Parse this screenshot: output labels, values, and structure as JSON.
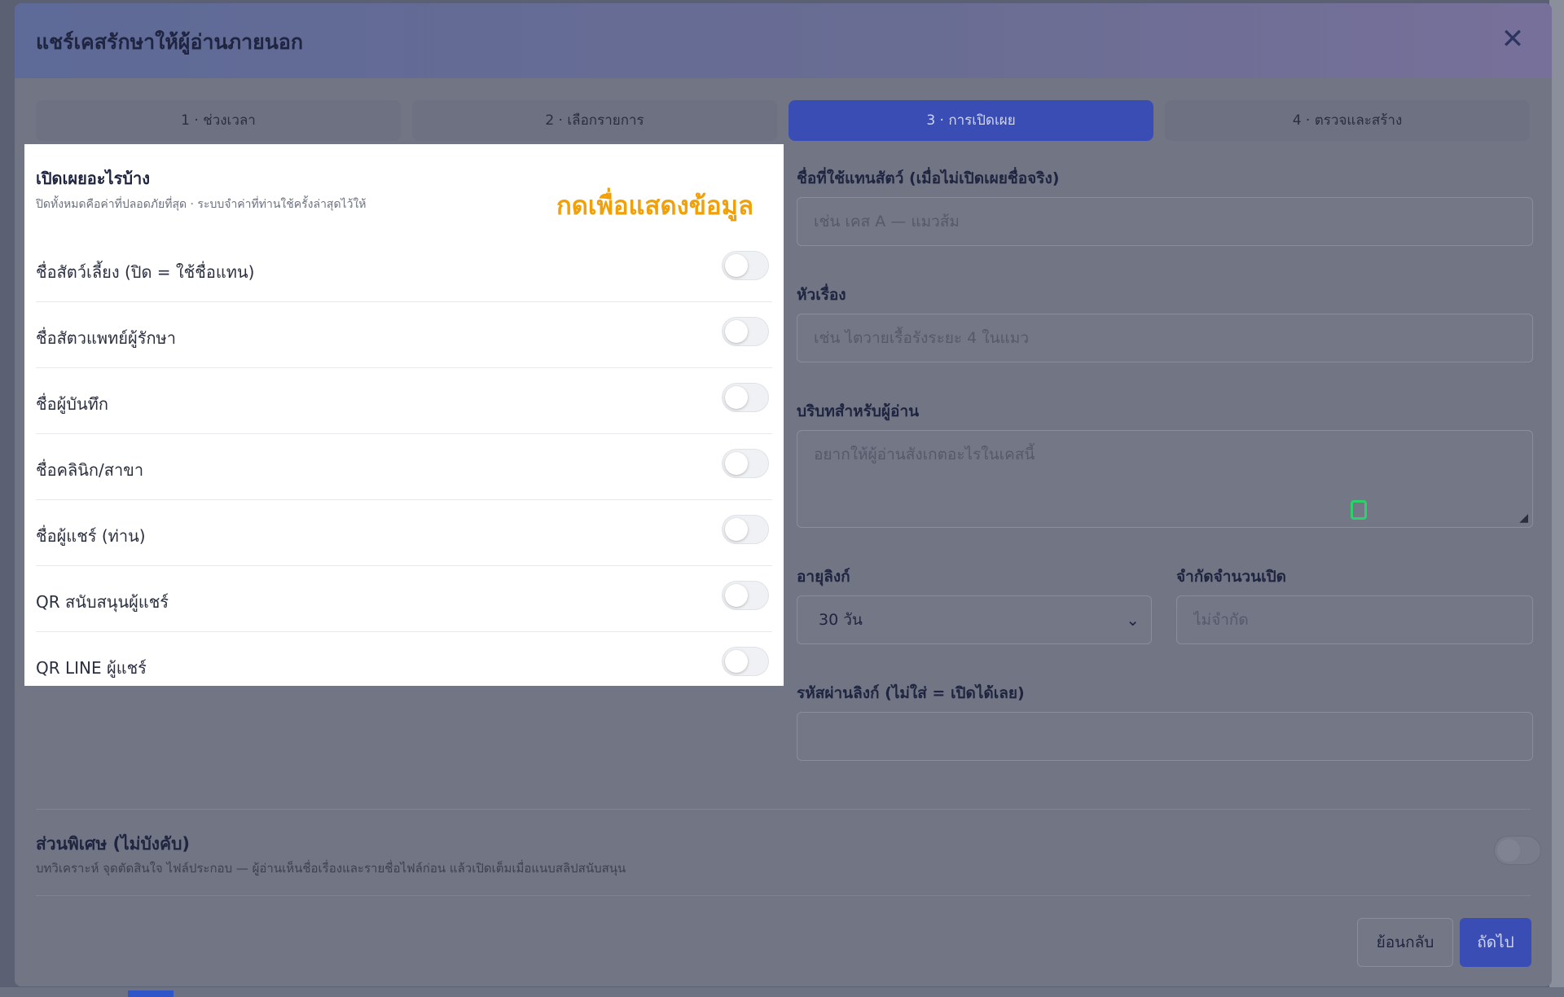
{
  "modal": {
    "title": "แชร์เคสรักษาให้ผู้อ่านภายนอก",
    "close_icon": "close-icon"
  },
  "steps": [
    {
      "label": "1 · ช่วงเวลา",
      "active": false
    },
    {
      "label": "2 · เลือกรายการ",
      "active": false
    },
    {
      "label": "3 · การเปิดเผย",
      "active": true
    },
    {
      "label": "4 · ตรวจและสร้าง",
      "active": false
    }
  ],
  "disclosure": {
    "heading": "เปิดเผยอะไรบ้าง",
    "subtitle": "ปิดทั้งหมดคือค่าที่ปลอดภัยที่สุด · ระบบจำค่าที่ท่านใช้ครั้งล่าสุดไว้ให้",
    "callout": "กดเพื่อแสดงข้อมูล",
    "toggles": [
      {
        "label": "ชื่อสัตว์เลี้ยง (ปิด = ใช้ชื่อแทน)",
        "on": false
      },
      {
        "label": "ชื่อสัตวแพทย์ผู้รักษา",
        "on": false
      },
      {
        "label": "ชื่อผู้บันทึก",
        "on": false
      },
      {
        "label": "ชื่อคลินิก/สาขา",
        "on": false
      },
      {
        "label": "ชื่อผู้แชร์ (ท่าน)",
        "on": false
      },
      {
        "label": "QR สนับสนุนผู้แชร์",
        "on": false
      },
      {
        "label": "QR LINE ผู้แชร์",
        "on": false
      }
    ]
  },
  "form": {
    "alias_label": "ชื่อที่ใช้แทนสัตว์ (เมื่อไม่เปิดเผยชื่อจริง)",
    "alias_placeholder": "เช่น เคส A — แมวส้ม",
    "title_label": "หัวเรื่อง",
    "title_placeholder": "เช่น ไตวายเรื้อรังระยะ 4 ในแมว",
    "context_label": "บริบทสำหรับผู้อ่าน",
    "context_placeholder": "อยากให้ผู้อ่านสังเกตอะไรในเคสนี้",
    "expiry_label": "อายุลิงก์",
    "expiry_value": "30 วัน",
    "limit_label": "จำกัดจำนวนเปิด",
    "limit_placeholder": "ไม่จำกัด",
    "password_label": "รหัสผ่านลิงก์ (ไม่ใส่ = เปิดได้เลย)",
    "password_value": ""
  },
  "extra": {
    "title": "ส่วนพิเศษ (ไม่บังคับ)",
    "subtitle": "บทวิเคราะห์ จุดตัดสินใจ ไฟล์ประกอบ — ผู้อ่านเห็นชื่อเรื่องและรายชื่อไฟล์ก่อน แล้วเปิดเต็มเมื่อแนบสลิปสนับสนุน",
    "enabled": false
  },
  "footer": {
    "back_label": "ย้อนกลับ",
    "next_label": "ถัดไป"
  },
  "colors": {
    "accent": "#3a4db5",
    "callout": "#f2a007",
    "cursor_highlight": "#2ed06a"
  }
}
